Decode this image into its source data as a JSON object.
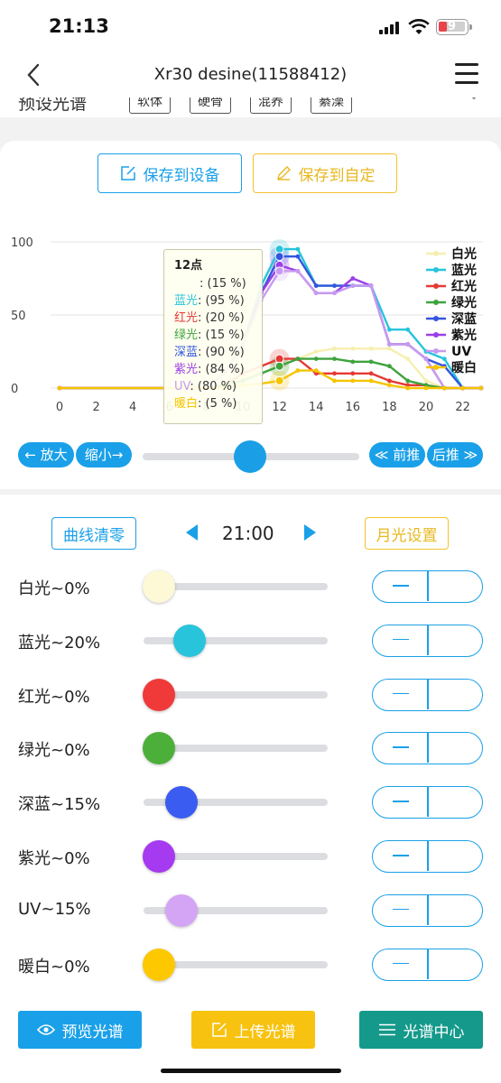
{
  "status": {
    "time": "21:13",
    "battery": "9"
  },
  "nav": {
    "title": "Xr30 desine(11588412)"
  },
  "preset": {
    "label": "预设光谱",
    "chips": [
      "软体",
      "硬骨",
      "混养",
      "綦澡"
    ]
  },
  "actions": {
    "save_device": "保存到设备",
    "save_custom": "保存到自定"
  },
  "chart_data": {
    "type": "line",
    "x_ticks": [
      0,
      2,
      4,
      6,
      8,
      10,
      12,
      14,
      16,
      18,
      20,
      22
    ],
    "y_ticks": [
      0,
      50,
      100
    ],
    "xlim": [
      0,
      23
    ],
    "ylim": [
      0,
      100
    ],
    "legend_position": "right",
    "series": [
      {
        "name": "白光",
        "color": "#f5efb0",
        "x": [
          0,
          8,
          9,
          10,
          11,
          12,
          13,
          14,
          15,
          16,
          17,
          18,
          19,
          20,
          21,
          22,
          23
        ],
        "y": [
          0,
          0,
          3,
          7,
          10,
          15,
          20,
          25,
          27,
          27,
          27,
          27,
          20,
          5,
          0,
          0,
          0
        ]
      },
      {
        "name": "蓝光",
        "color": "#27c4dc",
        "x": [
          0,
          8,
          9,
          10,
          11,
          12,
          13,
          14,
          15,
          16,
          17,
          18,
          19,
          20,
          21,
          22,
          23
        ],
        "y": [
          0,
          0,
          10,
          30,
          70,
          95,
          95,
          70,
          70,
          70,
          70,
          40,
          40,
          25,
          20,
          0,
          0
        ]
      },
      {
        "name": "红光",
        "color": "#e53935",
        "x": [
          0,
          8,
          9,
          10,
          11,
          12,
          13,
          14,
          15,
          16,
          17,
          18,
          19,
          20,
          21,
          22,
          23
        ],
        "y": [
          0,
          0,
          2,
          10,
          15,
          20,
          20,
          10,
          10,
          10,
          10,
          5,
          2,
          2,
          0,
          0,
          0
        ]
      },
      {
        "name": "绿光",
        "color": "#3da33d",
        "x": [
          0,
          8,
          9,
          10,
          11,
          12,
          13,
          14,
          15,
          16,
          17,
          18,
          19,
          20,
          21,
          22,
          23
        ],
        "y": [
          0,
          0,
          2,
          5,
          10,
          15,
          20,
          20,
          20,
          18,
          18,
          15,
          5,
          2,
          0,
          0,
          0
        ]
      },
      {
        "name": "深蓝",
        "color": "#3355dd",
        "x": [
          0,
          8,
          9,
          10,
          11,
          12,
          13,
          14,
          15,
          16,
          17,
          18,
          19,
          20,
          21,
          22,
          23
        ],
        "y": [
          0,
          0,
          10,
          30,
          65,
          90,
          90,
          70,
          70,
          70,
          70,
          30,
          30,
          20,
          15,
          0,
          0
        ]
      },
      {
        "name": "紫光",
        "color": "#9b3fe8",
        "x": [
          0,
          8,
          9,
          10,
          11,
          12,
          13,
          14,
          15,
          16,
          17,
          18,
          19,
          20,
          21,
          22,
          23
        ],
        "y": [
          0,
          0,
          10,
          30,
          65,
          84,
          80,
          65,
          65,
          75,
          70,
          30,
          30,
          20,
          0,
          0,
          0
        ]
      },
      {
        "name": "UV",
        "color": "#c79af0",
        "x": [
          0,
          8,
          9,
          10,
          11,
          12,
          13,
          14,
          15,
          16,
          17,
          18,
          19,
          20,
          21,
          22,
          23
        ],
        "y": [
          0,
          0,
          10,
          30,
          60,
          80,
          80,
          65,
          65,
          70,
          70,
          30,
          30,
          20,
          0,
          0,
          0
        ]
      },
      {
        "name": "暖白",
        "color": "#f5c400",
        "x": [
          0,
          8,
          9,
          10,
          11,
          12,
          13,
          14,
          15,
          16,
          17,
          18,
          19,
          20,
          21,
          22,
          23
        ],
        "y": [
          0,
          0,
          0,
          2,
          3,
          5,
          12,
          12,
          5,
          5,
          5,
          2,
          0,
          0,
          0,
          0,
          0
        ]
      }
    ],
    "tooltip": {
      "title": "12点",
      "rows": [
        {
          "name": "",
          "value": ": (15 %)"
        },
        {
          "name": "蓝光",
          "value": ": (95 %)"
        },
        {
          "name": "红光",
          "value": ": (20 %)"
        },
        {
          "name": "绿光",
          "value": ": (15 %)"
        },
        {
          "name": "深蓝",
          "value": ": (90 %)"
        },
        {
          "name": "紫光",
          "value": ": (84 %)"
        },
        {
          "name": "UV",
          "value": ": (80 %)"
        },
        {
          "name": "暖白",
          "value": ": (5 %)"
        }
      ]
    }
  },
  "zoom": {
    "zoom_in": "← 放大",
    "zoom_out": "缩小→",
    "forward": "≪ 前推",
    "backward": "后推 ≫",
    "position": 0.5
  },
  "controls": {
    "clear": "曲线清零",
    "time": "21:00",
    "moon": "月光设置"
  },
  "channels": [
    {
      "label": "白光~0%",
      "value": 0,
      "color": "#fdf8d6"
    },
    {
      "label": "蓝光~20%",
      "value": 20,
      "color": "#27c4dc"
    },
    {
      "label": "红光~0%",
      "value": 0,
      "color": "#f03a3a"
    },
    {
      "label": "绿光~0%",
      "value": 0,
      "color": "#4caf3a"
    },
    {
      "label": "深蓝~15%",
      "value": 15,
      "color": "#3a5cf0"
    },
    {
      "label": "紫光~0%",
      "value": 0,
      "color": "#a63af0"
    },
    {
      "label": "UV~15%",
      "value": 15,
      "color": "#d4a4f5"
    },
    {
      "label": "暖白~0%",
      "value": 0,
      "color": "#fdc800"
    }
  ],
  "bottom": {
    "preview": "预览光谱",
    "upload": "上传光谱",
    "center": "光谱中心"
  },
  "colors": {
    "accent": "#1aa0e8",
    "yellow": "#f7c210",
    "teal": "#14998a"
  }
}
